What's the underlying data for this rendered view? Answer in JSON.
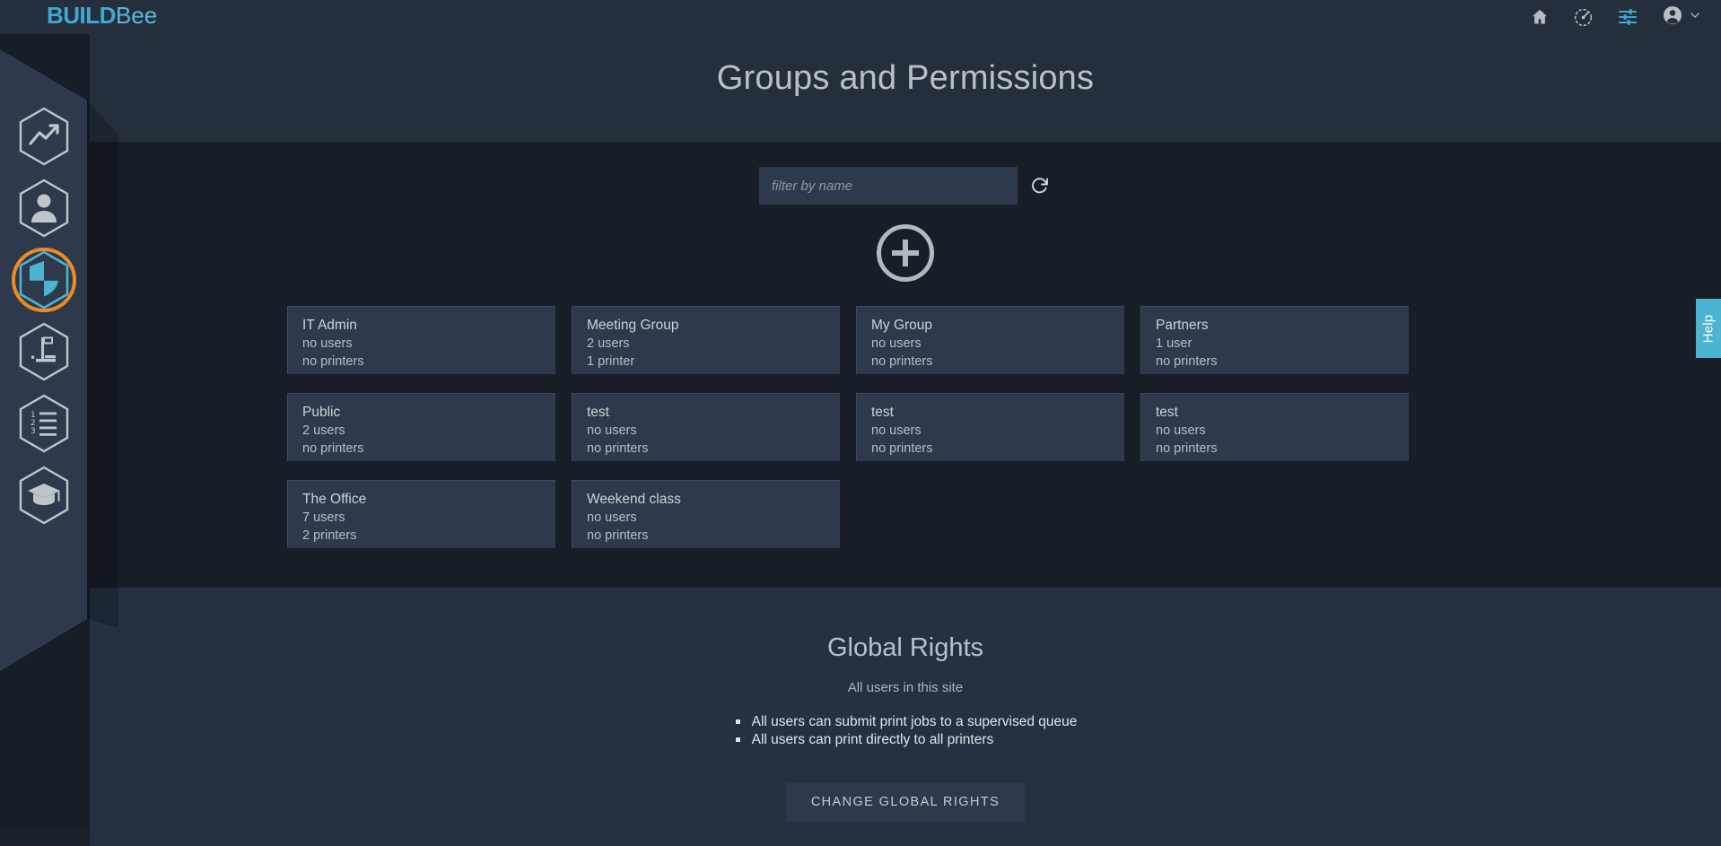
{
  "app": {
    "logo_bold": "BUILD",
    "logo_light": "Bee",
    "brand_color": "#4fb3d9",
    "active_color": "#f08a24",
    "help_color": "#4cb4d1"
  },
  "topbar": {
    "icons": [
      {
        "name": "home-icon",
        "label": "Home"
      },
      {
        "name": "monitor-dashboard-icon",
        "label": "Monitor"
      },
      {
        "name": "settings-sliders-icon",
        "label": "Settings",
        "color": "#3fa9d1"
      },
      {
        "name": "account-circle-icon",
        "label": "Account"
      },
      {
        "name": "chevron-down-icon",
        "label": "Account menu"
      }
    ]
  },
  "sidebar": {
    "items": [
      {
        "name": "sidebar-item-statistics",
        "icon": "chart-line-icon",
        "label": "Statistics",
        "active": false
      },
      {
        "name": "sidebar-item-users",
        "icon": "person-icon",
        "label": "Users",
        "active": false
      },
      {
        "name": "sidebar-item-permissions",
        "icon": "shield-icon",
        "label": "Groups and Permissions",
        "active": true
      },
      {
        "name": "sidebar-item-printers",
        "icon": "printer-icon",
        "label": "Printers",
        "active": false
      },
      {
        "name": "sidebar-item-queue",
        "icon": "numbered-list-icon",
        "label": "Queue",
        "active": false
      },
      {
        "name": "sidebar-item-learning",
        "icon": "graduation-cap-icon",
        "label": "Learning",
        "active": false
      }
    ]
  },
  "header": {
    "title": "Groups and Permissions"
  },
  "filter": {
    "placeholder": "filter by name",
    "value": "",
    "refresh_label": "Refresh"
  },
  "add_group": {
    "label": "Add group"
  },
  "groups": [
    {
      "name": "IT Admin",
      "users": "no users",
      "printers": "no printers"
    },
    {
      "name": "Meeting Group",
      "users": "2 users",
      "printers": "1 printer"
    },
    {
      "name": "My Group",
      "users": "no users",
      "printers": "no printers"
    },
    {
      "name": "Partners",
      "users": "1 user",
      "printers": "no printers"
    },
    {
      "name": "Public",
      "users": "2 users",
      "printers": "no printers"
    },
    {
      "name": "test",
      "users": "no users",
      "printers": "no printers"
    },
    {
      "name": "test",
      "users": "no users",
      "printers": "no printers"
    },
    {
      "name": "test",
      "users": "no users",
      "printers": "no printers"
    },
    {
      "name": "The Office",
      "users": "7 users",
      "printers": "2 printers"
    },
    {
      "name": "Weekend class",
      "users": "no users",
      "printers": "no printers"
    }
  ],
  "global_rights": {
    "title": "Global Rights",
    "subtitle": "All users in this site",
    "rights": [
      "All users can submit print jobs to a supervised queue",
      "All users can print directly to all printers"
    ],
    "change_button": "CHANGE GLOBAL RIGHTS"
  },
  "help": {
    "label": "Help"
  }
}
